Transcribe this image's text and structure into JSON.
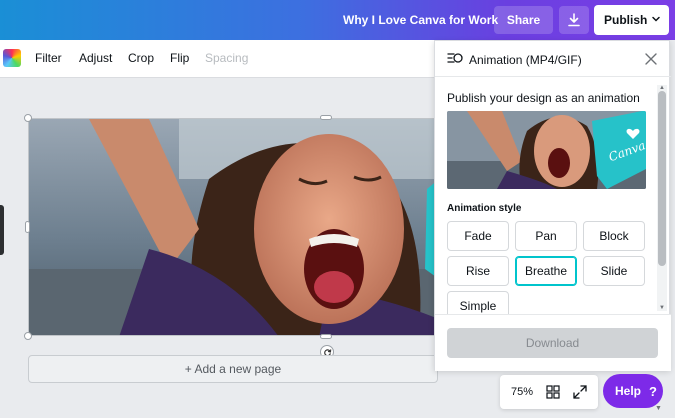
{
  "topbar": {
    "doc_title": "Why I Love Canva for Work",
    "share_label": "Share",
    "download_icon": "download-icon",
    "publish_label": "Publish"
  },
  "toolbar": {
    "items": [
      {
        "label": "Filter",
        "enabled": true
      },
      {
        "label": "Adjust",
        "enabled": true
      },
      {
        "label": "Crop",
        "enabled": true
      },
      {
        "label": "Flip",
        "enabled": true
      },
      {
        "label": "Spacing",
        "enabled": false
      }
    ]
  },
  "canvas": {
    "add_page_label": "+ Add a new page"
  },
  "panel": {
    "title": "Animation (MP4/GIF)",
    "subtitle": "Publish your design as an animation",
    "style_label": "Animation style",
    "styles": [
      {
        "label": "Fade",
        "selected": false
      },
      {
        "label": "Pan",
        "selected": false
      },
      {
        "label": "Block",
        "selected": false
      },
      {
        "label": "Rise",
        "selected": false
      },
      {
        "label": "Breathe",
        "selected": true
      },
      {
        "label": "Slide",
        "selected": false
      },
      {
        "label": "Simple",
        "selected": false
      }
    ],
    "download_label": "Download",
    "preview_logo_text": "Canva"
  },
  "bottom": {
    "zoom_level": "75%",
    "help_label": "Help",
    "help_icon": "?"
  },
  "colors": {
    "accent_teal": "#00c4cc",
    "help_purple": "#7d2ae8",
    "topbar_start": "#1a8fd6",
    "topbar_end": "#7b3ee6"
  }
}
